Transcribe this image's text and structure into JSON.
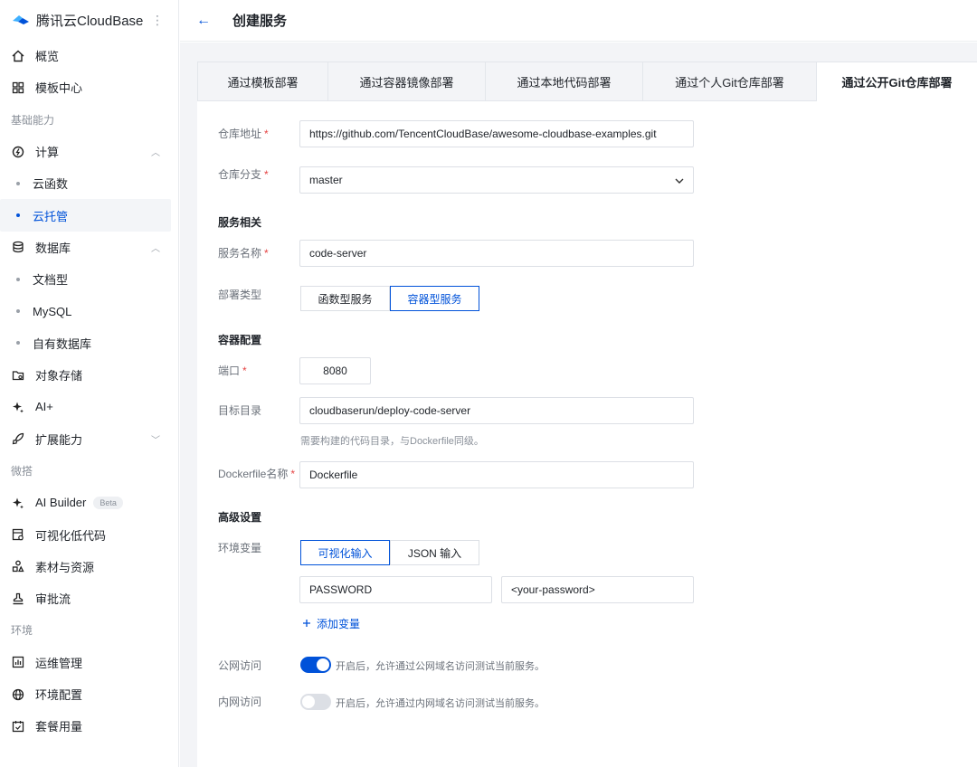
{
  "brand": {
    "name": "腾讯云CloudBase",
    "more": "⋮"
  },
  "header": {
    "back": "←",
    "title": "创建服务"
  },
  "sidebar": {
    "overview": "概览",
    "templates": "模板中心",
    "section_basic": "基础能力",
    "compute": "计算",
    "cloud_functions": "云函数",
    "cloud_hosting": "云托管",
    "database": "数据库",
    "doc_db": "文档型",
    "mysql": "MySQL",
    "own_db": "自有数据库",
    "storage": "对象存储",
    "ai_plus": "AI+",
    "extensions": "扩展能力",
    "section_weida": "微搭",
    "ai_builder": "AI Builder",
    "beta": "Beta",
    "lowcode": "可视化低代码",
    "assets": "素材与资源",
    "approval": "审批流",
    "section_env": "环境",
    "ops": "运维管理",
    "env_config": "环境配置",
    "plan_usage": "套餐用量"
  },
  "tabs": [
    {
      "label": "通过模板部署"
    },
    {
      "label": "通过容器镜像部署"
    },
    {
      "label": "通过本地代码部署"
    },
    {
      "label": "通过个人Git仓库部署"
    },
    {
      "label": "通过公开Git仓库部署"
    }
  ],
  "form": {
    "repo_label": "仓库地址",
    "repo_value": "https://github.com/TencentCloudBase/awesome-cloudbase-examples.git",
    "branch_label": "仓库分支",
    "branch_value": "master",
    "service_section": "服务相关",
    "service_name_label": "服务名称",
    "service_name_value": "code-server",
    "deploy_type_label": "部署类型",
    "deploy_type_function": "函数型服务",
    "deploy_type_container": "容器型服务",
    "container_section": "容器配置",
    "port_label": "端口",
    "port_value": "8080",
    "target_dir_label": "目标目录",
    "target_dir_value": "cloudbaserun/deploy-code-server",
    "target_dir_hint": "需要构建的代码目录，与Dockerfile同级。",
    "dockerfile_label": "Dockerfile名称",
    "dockerfile_value": "Dockerfile",
    "advanced_section": "高级设置",
    "env_label": "环境变量",
    "env_visual": "可视化输入",
    "env_json": "JSON 输入",
    "env_key": "PASSWORD",
    "env_value": "<your-password>",
    "add_var": "添加变量",
    "public_label": "公网访问",
    "public_text": "开启后，允许通过公网域名访问测试当前服务。",
    "public_enabled": true,
    "private_label": "内网访问",
    "private_text": "开启后，允许通过内网域名访问测试当前服务。",
    "private_enabled": false,
    "required_mark": "*"
  },
  "colors": {
    "accent": "#0052d9",
    "required": "#e54545"
  }
}
